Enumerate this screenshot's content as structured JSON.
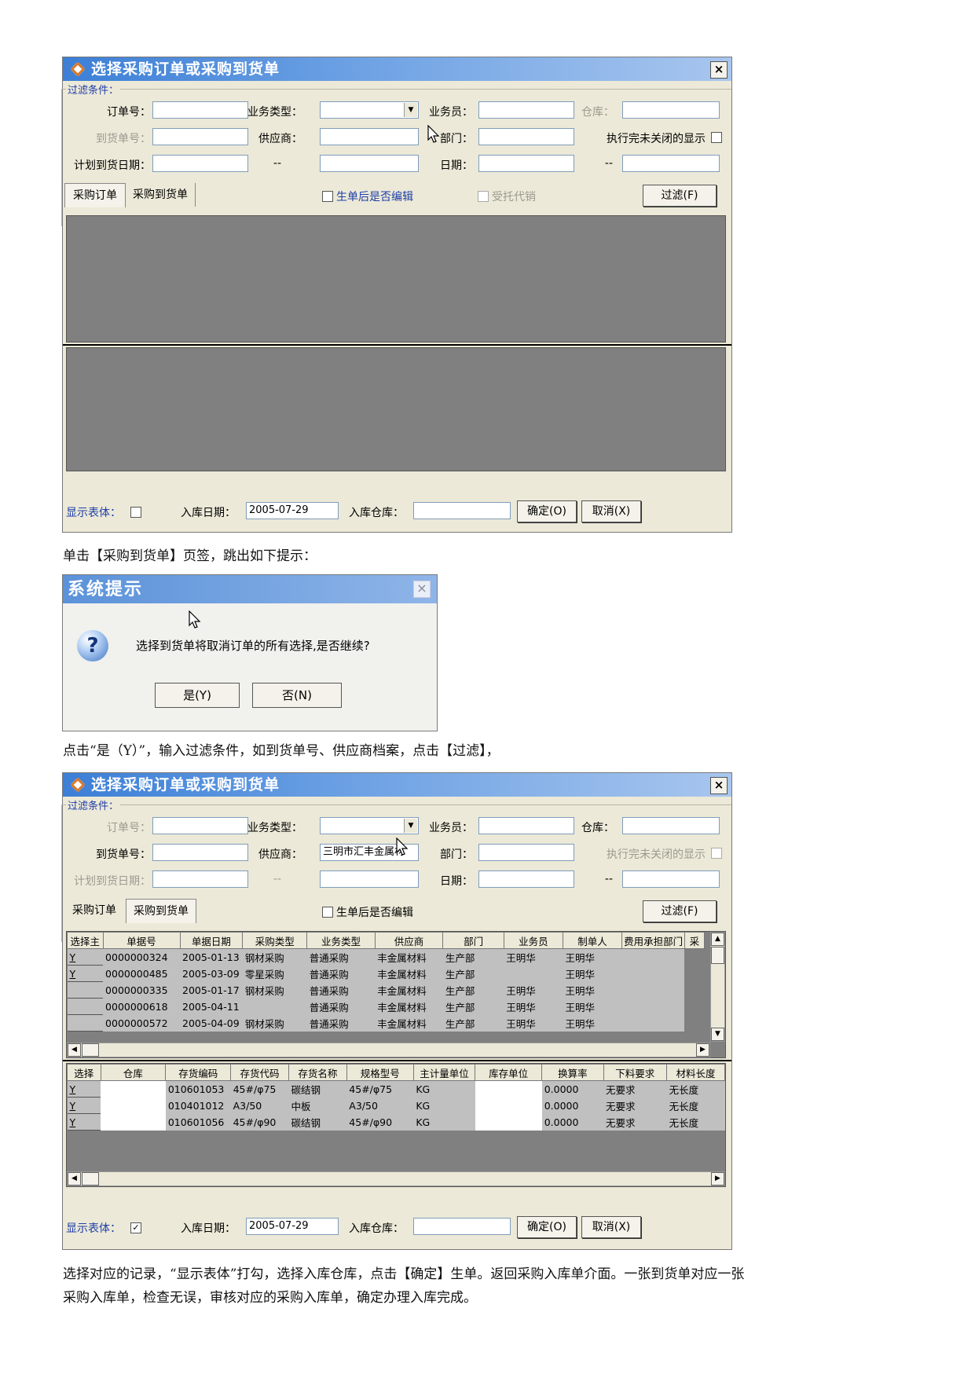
{
  "window1": {
    "title": "选择采购订单或采购到货单",
    "close": "×",
    "legend": "过滤条件：",
    "labels": {
      "order_no": "订单号：",
      "biz_type": "业务类型：",
      "salesman": "业务员：",
      "warehouse": "仓库：",
      "arrival_no": "到货单号：",
      "supplier": "供应商：",
      "dept": "部门：",
      "show_closed": "执行完未关闭的显示",
      "plan_date": "计划到货日期：",
      "dash": "--",
      "date": "日期：",
      "dash2": "--"
    },
    "tabs": [
      "采购订单",
      "采购到货单"
    ],
    "edit_after": "生单后是否编辑",
    "consign": "受托代销",
    "filter_btn": "过滤(F)",
    "show_body": "显示表体：",
    "in_date_label": "入库日期：",
    "in_date": "2005-07-29",
    "in_wh_label": "入库仓库：",
    "ok_btn": "确定(O)",
    "cancel_btn": "取消(X)"
  },
  "para1": "单击【采购到货单】页签，跳出如下提示：",
  "dialog": {
    "title": "系统提示",
    "close": "×",
    "message": "选择到货单将取消订单的所有选择,是否继续?",
    "yes": "是(Y)",
    "no": "否(N)",
    "icon": "question-icon"
  },
  "para2": "点击“是（Y）”，输入过滤条件，如到货单号、供应商档案，点击【过滤】，",
  "window2": {
    "title": "选择采购订单或采购到货单",
    "close": "×",
    "legend": "过滤条件：",
    "labels": {
      "order_no": "订单号：",
      "biz_type": "业务类型：",
      "salesman": "业务员：",
      "warehouse": "仓库：",
      "arrival_no": "到货单号：",
      "supplier": "供应商：",
      "dept": "部门：",
      "show_closed": "执行完未关闭的显示",
      "plan_date": "计划到货日期：",
      "dash": "--",
      "date": "日期：",
      "dash2": "--"
    },
    "supplier_value": "三明市汇丰金属材",
    "tabs": [
      "采购订单",
      "采购到货单"
    ],
    "edit_after": "生单后是否编辑",
    "filter_btn": "过滤(F)",
    "top_headers": [
      "选择主",
      "单据号",
      "单据日期",
      "采购类型",
      "业务类型",
      "供应商",
      "部门",
      "业务员",
      "制单人",
      "费用承担部门",
      "采"
    ],
    "top_rows": [
      [
        "Y",
        "0000000324",
        "2005-01-13",
        "钢材采购",
        "普通采购",
        "丰金属材料",
        "生产部",
        "王明华",
        "王明华",
        ""
      ],
      [
        "Y",
        "0000000485",
        "2005-03-09",
        "零星采购",
        "普通采购",
        "丰金属材料",
        "生产部",
        "",
        "王明华",
        ""
      ],
      [
        "",
        "0000000335",
        "2005-01-17",
        "钢材采购",
        "普通采购",
        "丰金属材料",
        "生产部",
        "王明华",
        "王明华",
        ""
      ],
      [
        "",
        "0000000618",
        "2005-04-11",
        "",
        "普通采购",
        "丰金属材料",
        "生产部",
        "王明华",
        "王明华",
        ""
      ],
      [
        "",
        "0000000572",
        "2005-04-09",
        "钢材采购",
        "普通采购",
        "丰金属材料",
        "生产部",
        "王明华",
        "王明华",
        ""
      ]
    ],
    "bottom_headers": [
      "选择",
      "仓库",
      "存货编码",
      "存货代码",
      "存货名称",
      "规格型号",
      "主计量单位",
      "库存单位",
      "换算率",
      "下料要求",
      "材料长度"
    ],
    "bottom_rows": [
      [
        "Y",
        "",
        "010601053",
        "45#/φ75",
        "碳结钢",
        "45#/φ75",
        "KG",
        "",
        "0.0000",
        "无要求",
        "无长度"
      ],
      [
        "Y",
        "",
        "010401012",
        "A3/50",
        "中板",
        "A3/50",
        "KG",
        "",
        "0.0000",
        "无要求",
        "无长度"
      ],
      [
        "Y",
        "",
        "010601056",
        "45#/φ90",
        "碳结钢",
        "45#/φ90",
        "KG",
        "",
        "0.0000",
        "无要求",
        "无长度"
      ]
    ],
    "show_body": "显示表体：",
    "show_body_checked": "✓",
    "in_date_label": "入库日期：",
    "in_date": "2005-07-29",
    "in_wh_label": "入库仓库：",
    "ok_btn": "确定(O)",
    "cancel_btn": "取消(X)"
  },
  "para3": "选择对应的记录，“显示表体”打勾，选择入库仓库，点击【确定】生单。返回采购入库单介面。一张到货单对应一张",
  "para4": "采购入库单，检查无误，审核对应的采购入库单，确定办理入库完成。"
}
